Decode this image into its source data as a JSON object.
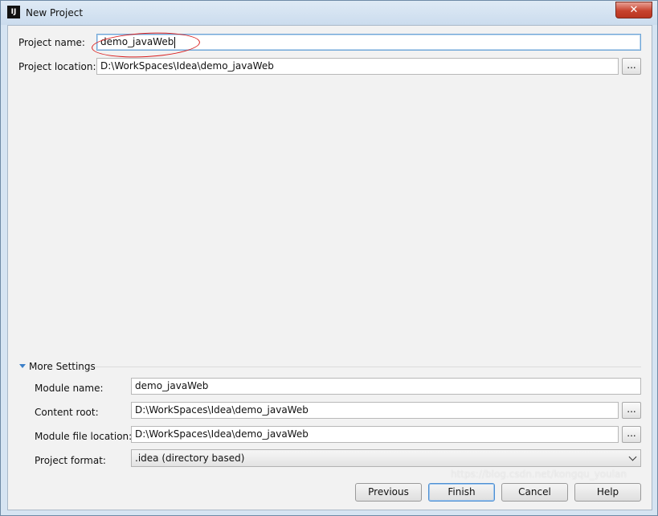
{
  "window": {
    "title": "New Project",
    "close_glyph": "✕",
    "app_icon_text": "IJ"
  },
  "project": {
    "name_label": "Project name:",
    "name_value": "demo_javaWeb",
    "location_label": "Project location:",
    "location_value": "D:\\WorkSpaces\\Idea\\demo_javaWeb",
    "browse_label": "..."
  },
  "more_settings": {
    "title": "More Settings",
    "module_name_label": "Module name:",
    "module_name_value": "demo_javaWeb",
    "content_root_label": "Content root:",
    "content_root_value": "D:\\WorkSpaces\\Idea\\demo_javaWeb",
    "module_file_label": "Module file location:",
    "module_file_value": "D:\\WorkSpaces\\Idea\\demo_javaWeb",
    "format_label": "Project format:",
    "format_value": ".idea (directory based)",
    "browse_label": "..."
  },
  "buttons": {
    "previous": "Previous",
    "finish": "Finish",
    "cancel": "Cancel",
    "help": "Help"
  },
  "watermark": "https://blog.csdn.net/kongqu_youlan",
  "colors": {
    "annotation": "#d81c1c",
    "focus": "#6fa6d8",
    "accent": "#3c7fc8"
  }
}
